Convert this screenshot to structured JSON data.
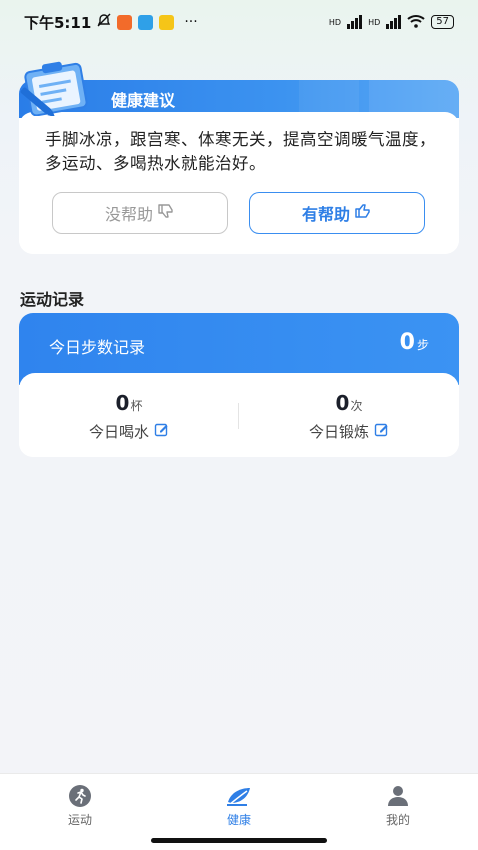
{
  "status_bar": {
    "time": "下午5:11",
    "more": "···",
    "net1": "HD",
    "net2": "HD",
    "battery": "57"
  },
  "health_card": {
    "title": "健康建议",
    "advice": "手脚冰凉，跟宫寒、体寒无关，提高空调暖气温度，多运动、多喝热水就能治好。",
    "not_helpful_label": "没帮助",
    "helpful_label": "有帮助",
    "accent_color": "#2f7fe6"
  },
  "section": {
    "title": "运动记录"
  },
  "record": {
    "steps_label": "今日步数记录",
    "steps_value": "0",
    "steps_unit": "步",
    "water_value": "0",
    "water_unit": "杯",
    "water_label": "今日喝水",
    "exercise_value": "0",
    "exercise_unit": "次",
    "exercise_label": "今日锻炼"
  },
  "tabs": [
    {
      "label": "运动",
      "icon": "running-icon",
      "active": false
    },
    {
      "label": "健康",
      "icon": "health-leaf-icon",
      "active": true
    },
    {
      "label": "我的",
      "icon": "user-icon",
      "active": false
    }
  ]
}
